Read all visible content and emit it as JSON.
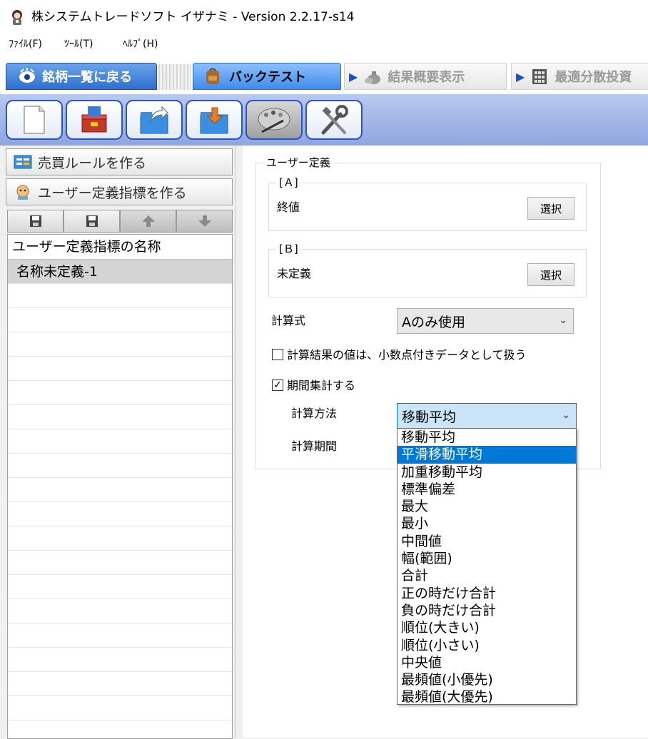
{
  "window": {
    "title": "株システムトレードソフト イザナミ - Version 2.2.17-s14"
  },
  "menu": {
    "items": [
      "ﾌｧｲﾙ(F)",
      "ﾂｰﾙ(T)",
      "ﾍﾙﾌﾟ(H)"
    ]
  },
  "tabs": {
    "list_label": "銘柄一覧に戻る",
    "backtest_label": "バックテスト",
    "result_label": "結果概要表示",
    "optimal_label": "最適分散投資"
  },
  "toolbar": {
    "icons": [
      "new-document-icon",
      "import-chest-icon",
      "export-folder-icon",
      "import-folder-icon",
      "palette-icon",
      "tools-icon"
    ]
  },
  "left": {
    "create_rule_label": "売買ルールを作る",
    "create_indicator_label": "ユーザー定義指標を作る",
    "grid_header": "ユーザー定義指標の名称",
    "rows": [
      "名称未定義-1"
    ]
  },
  "right": {
    "group_title": "ユーザー定義",
    "a": {
      "title": "[Ａ]",
      "value": "終値",
      "select_label": "選択"
    },
    "b": {
      "title": "[Ｂ]",
      "value": "未定義",
      "select_label": "選択"
    },
    "formula_label": "計算式",
    "formula_value": "Aのみ使用",
    "decimal_checkbox_label": "計算結果の値は、小数点付きデータとして扱う",
    "decimal_checked": false,
    "period_checkbox_label": "期間集計する",
    "period_checked": true,
    "method_label": "計算方法",
    "method_value": "移動平均",
    "period_label": "計算期間"
  },
  "dropdown": {
    "highlighted_index": 1,
    "options": [
      "移動平均",
      "平滑移動平均",
      "加重移動平均",
      "標準偏差",
      "最大",
      "最小",
      "中間値",
      "幅(範囲)",
      "合計",
      "正の時だけ合計",
      "負の時だけ合計",
      "順位(大きい)",
      "順位(小さい)",
      "中央値",
      "最頻値(小優先)",
      "最頻値(大優先)"
    ]
  }
}
